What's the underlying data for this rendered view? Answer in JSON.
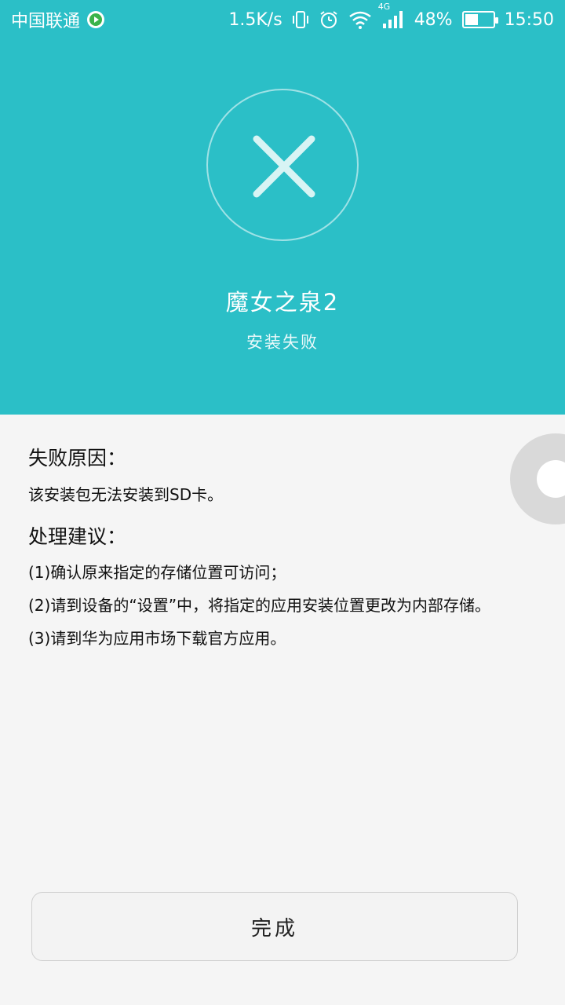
{
  "status_bar": {
    "carrier": "中国联通",
    "net_speed": "1.5K/s",
    "network_type": "4G",
    "battery": "48%",
    "battery_level": 0.48,
    "time": "15:50"
  },
  "result": {
    "app_name": "魔女之泉2",
    "status": "安装失败",
    "icon": "close-x-icon"
  },
  "failure": {
    "title": "失败原因：",
    "reason": "该安装包无法安装到SD卡。"
  },
  "suggestions": {
    "title": "处理建议：",
    "items": [
      "(1)确认原来指定的存储位置可访问；",
      "(2)请到设备的“设置”中，将指定的应用安装位置更改为内部存储。",
      "(3)请到华为应用市场下载官方应用。"
    ]
  },
  "actions": {
    "done_label": "完成"
  },
  "colors": {
    "accent": "#2bbfc7",
    "background": "#f5f5f5"
  }
}
